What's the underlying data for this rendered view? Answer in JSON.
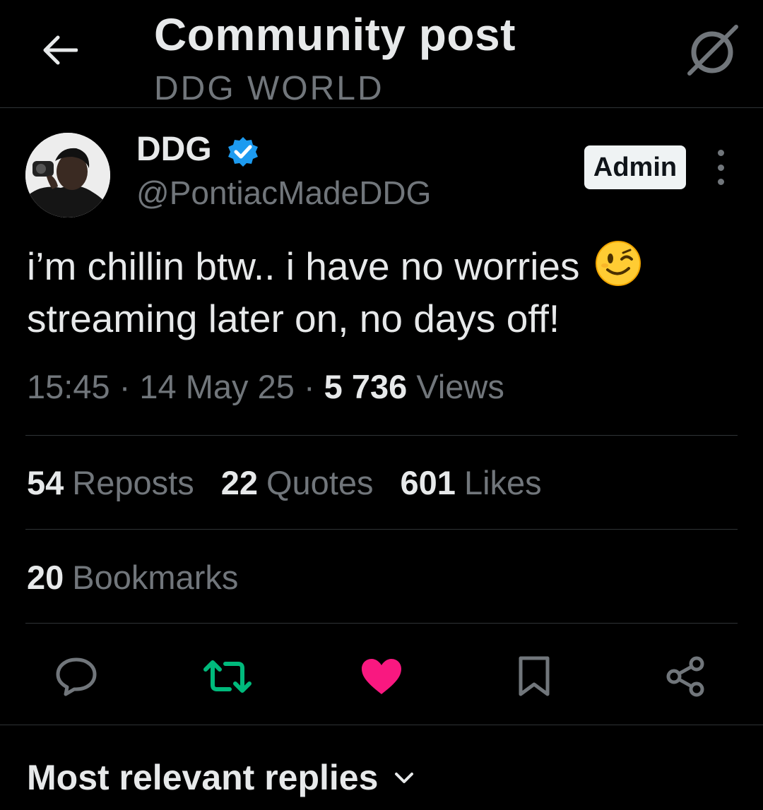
{
  "header": {
    "title": "Community post",
    "subtitle": "DDG WORLD"
  },
  "author": {
    "name": "DDG",
    "handle": "@PontiacMadeDDG",
    "badge": "Admin",
    "verified_color": "#1d9bf0"
  },
  "post": {
    "line1": "i’m chillin btw.. i have no worries",
    "line2": "streaming later on, no days off!",
    "emoji": "winking-face",
    "time": "15:45",
    "date": "14 May 25",
    "views_count": "5 736",
    "views_label": "Views"
  },
  "stats": {
    "reposts_count": "54",
    "reposts_label": "Reposts",
    "quotes_count": "22",
    "quotes_label": "Quotes",
    "likes_count": "601",
    "likes_label": "Likes",
    "bookmarks_count": "20",
    "bookmarks_label": "Bookmarks"
  },
  "actions": {
    "reply_icon": "speech-bubble-icon",
    "repost_icon": "repost-arrows-icon",
    "like_icon": "heart-filled-icon",
    "bookmark_icon": "bookmark-icon",
    "share_icon": "share-nodes-icon",
    "repost_color": "#00ba7c",
    "like_color": "#f91880"
  },
  "replies": {
    "sort_label": "Most relevant replies"
  }
}
